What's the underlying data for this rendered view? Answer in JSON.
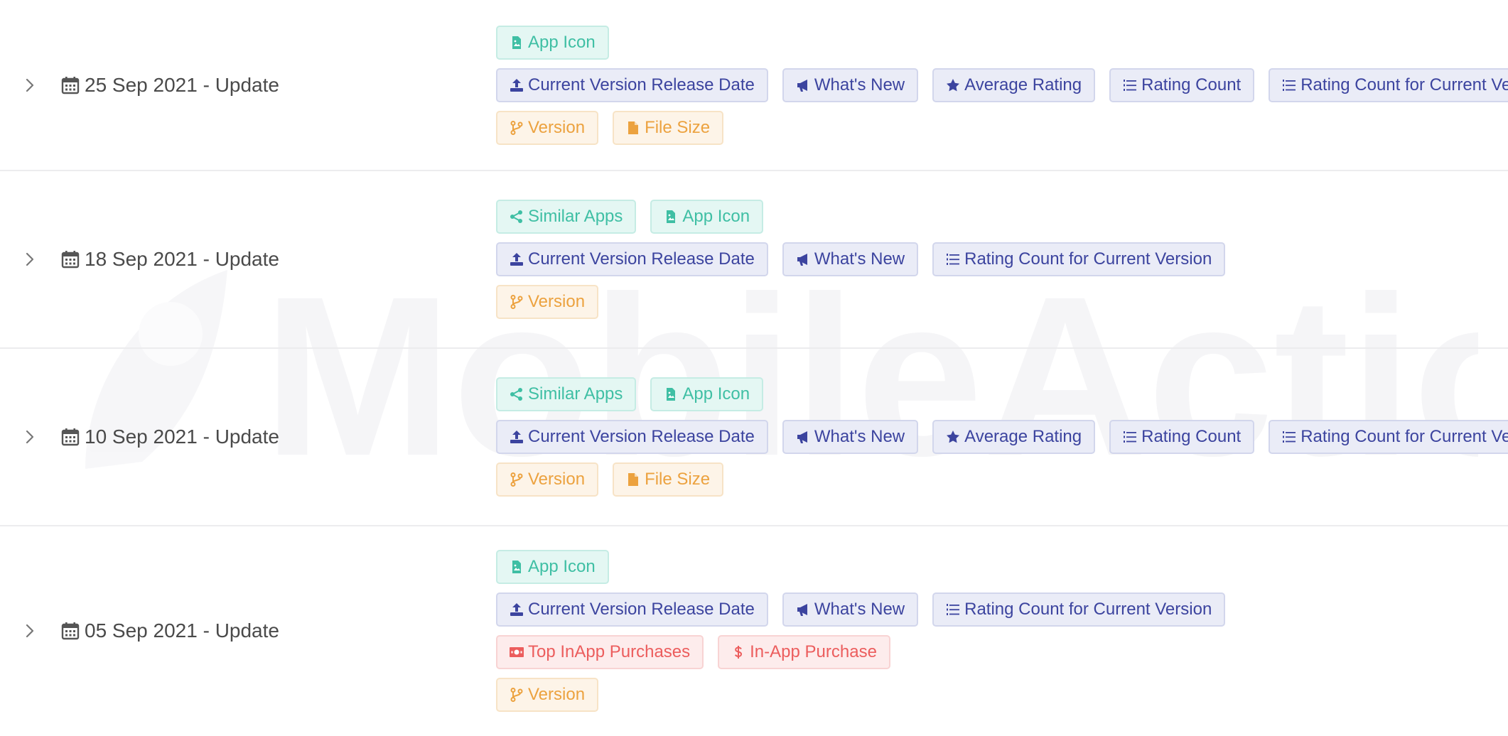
{
  "watermark": "MobileAction",
  "colors": {
    "green": "#3fbfa4",
    "blue": "#3c449f",
    "orange": "#eca23f",
    "red": "#ec5d5d",
    "divider": "#ececee"
  },
  "rows": [
    {
      "date_label": "25 Sep 2021 - Update",
      "icons": {
        "expand": "chevron-right-icon",
        "date": "calendar-icon"
      },
      "lines": [
        [
          {
            "label": "App Icon",
            "color": "green",
            "icon": "image-file-icon"
          }
        ],
        [
          {
            "label": "Current Version Release Date",
            "color": "blue",
            "icon": "upload-icon"
          },
          {
            "label": "What's New",
            "color": "blue",
            "icon": "megaphone-icon"
          },
          {
            "label": "Average Rating",
            "color": "blue",
            "icon": "star-icon"
          },
          {
            "label": "Rating Count",
            "color": "blue",
            "icon": "list-icon"
          },
          {
            "label": "Rating Count for Current Version",
            "color": "blue",
            "icon": "list-icon"
          }
        ],
        [
          {
            "label": "Version",
            "color": "orange",
            "icon": "branch-icon"
          },
          {
            "label": "File Size",
            "color": "orange",
            "icon": "file-icon"
          }
        ]
      ]
    },
    {
      "date_label": "18 Sep 2021 - Update",
      "icons": {
        "expand": "chevron-right-icon",
        "date": "calendar-icon"
      },
      "lines": [
        [
          {
            "label": "Similar Apps",
            "color": "green",
            "icon": "share-icon"
          },
          {
            "label": "App Icon",
            "color": "green",
            "icon": "image-file-icon"
          }
        ],
        [
          {
            "label": "Current Version Release Date",
            "color": "blue",
            "icon": "upload-icon"
          },
          {
            "label": "What's New",
            "color": "blue",
            "icon": "megaphone-icon"
          },
          {
            "label": "Rating Count for Current Version",
            "color": "blue",
            "icon": "list-icon"
          }
        ],
        [
          {
            "label": "Version",
            "color": "orange",
            "icon": "branch-icon"
          }
        ]
      ]
    },
    {
      "date_label": "10 Sep 2021 - Update",
      "icons": {
        "expand": "chevron-right-icon",
        "date": "calendar-icon"
      },
      "lines": [
        [
          {
            "label": "Similar Apps",
            "color": "green",
            "icon": "share-icon"
          },
          {
            "label": "App Icon",
            "color": "green",
            "icon": "image-file-icon"
          }
        ],
        [
          {
            "label": "Current Version Release Date",
            "color": "blue",
            "icon": "upload-icon"
          },
          {
            "label": "What's New",
            "color": "blue",
            "icon": "megaphone-icon"
          },
          {
            "label": "Average Rating",
            "color": "blue",
            "icon": "star-icon"
          },
          {
            "label": "Rating Count",
            "color": "blue",
            "icon": "list-icon"
          },
          {
            "label": "Rating Count for Current Version",
            "color": "blue",
            "icon": "list-icon"
          }
        ],
        [
          {
            "label": "Version",
            "color": "orange",
            "icon": "branch-icon"
          },
          {
            "label": "File Size",
            "color": "orange",
            "icon": "file-icon"
          }
        ]
      ]
    },
    {
      "date_label": "05 Sep 2021 - Update",
      "icons": {
        "expand": "chevron-right-icon",
        "date": "calendar-icon"
      },
      "lines": [
        [
          {
            "label": "App Icon",
            "color": "green",
            "icon": "image-file-icon"
          }
        ],
        [
          {
            "label": "Current Version Release Date",
            "color": "blue",
            "icon": "upload-icon"
          },
          {
            "label": "What's New",
            "color": "blue",
            "icon": "megaphone-icon"
          },
          {
            "label": "Rating Count for Current Version",
            "color": "blue",
            "icon": "list-icon"
          }
        ],
        [
          {
            "label": "Top InApp Purchases",
            "color": "red",
            "icon": "money-bill-icon"
          },
          {
            "label": "In-App Purchase",
            "color": "red",
            "icon": "dollar-icon"
          }
        ],
        [
          {
            "label": "Version",
            "color": "orange",
            "icon": "branch-icon"
          }
        ]
      ]
    }
  ]
}
